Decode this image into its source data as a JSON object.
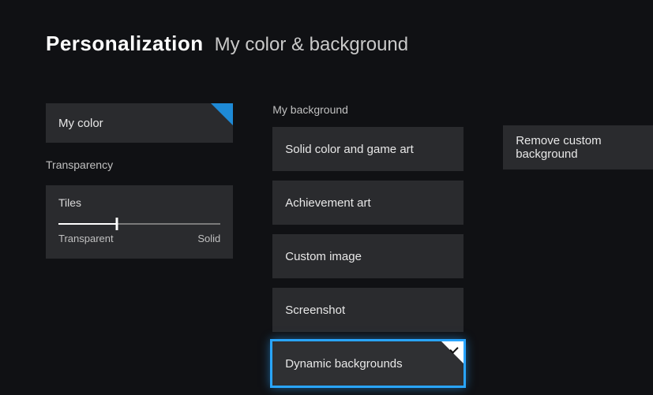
{
  "header": {
    "main": "Personalization",
    "sub": "My color & background"
  },
  "left": {
    "my_color_label": "My color",
    "transparency_label": "Transparency",
    "tiles_label": "Tiles",
    "slider_value_pct": 36,
    "slider_left_label": "Transparent",
    "slider_right_label": "Solid"
  },
  "mid": {
    "section_label": "My background",
    "options": [
      "Solid color and game art",
      "Achievement art",
      "Custom image",
      "Screenshot",
      "Dynamic backgrounds"
    ],
    "selected_index": 4
  },
  "right": {
    "remove_label": "Remove custom background"
  }
}
